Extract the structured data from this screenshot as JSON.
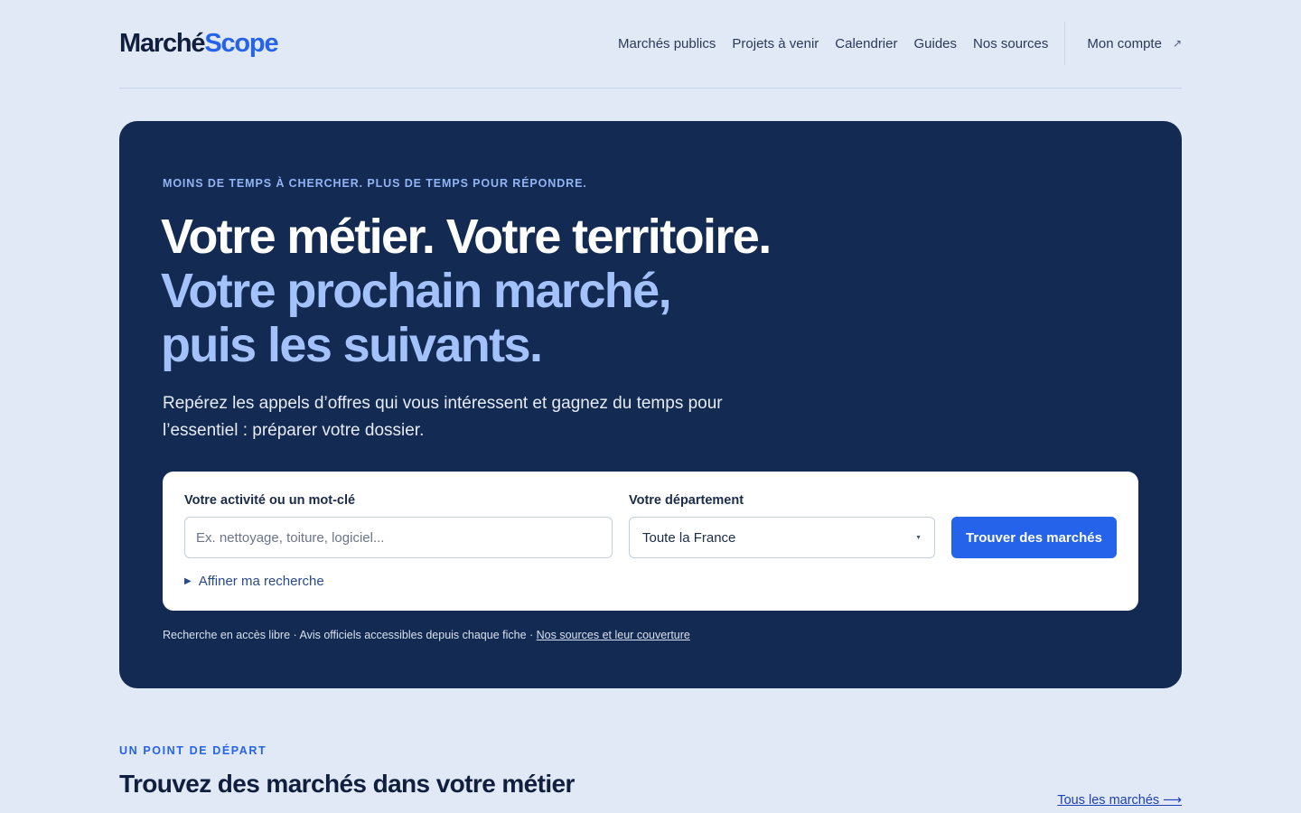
{
  "brand": {
    "part1": "Marché",
    "part2": "Scope"
  },
  "nav": {
    "links": [
      "Marchés publics",
      "Projets à venir",
      "Calendrier",
      "Guides",
      "Nos sources"
    ],
    "account_label": "Mon compte",
    "account_icon": "external-arrow-icon"
  },
  "hero": {
    "eyebrow": "MOINS DE TEMPS À CHERCHER. PLUS DE TEMPS POUR RÉPONDRE.",
    "headline_line1": "Votre métier. Votre territoire.",
    "headline_line2": "Votre prochain marché,",
    "headline_line3": "puis les suivants.",
    "lead": "Repérez les appels d’offres qui vous intéressent et gagnez du temps pour l’essentiel : préparer votre dossier."
  },
  "search": {
    "keyword_label": "Votre activité ou un mot-clé",
    "keyword_placeholder": "Ex. nettoyage, toiture, logiciel...",
    "keyword_value": "",
    "department_label": "Votre département",
    "department_value": "Toute la France",
    "submit_label": "Trouver des marchés",
    "refine_label": "Affiner ma recherche"
  },
  "note": {
    "text": "Recherche en accès libre · Avis officiels accessibles depuis chaque fiche · ",
    "link": "Nos sources et leur couverture"
  },
  "section": {
    "eyebrow": "UN POINT DE DÉPART",
    "title": "Trouvez des marchés dans votre métier",
    "link": "Tous les marchés ⟶"
  },
  "colors": {
    "page_bg": "#e2e9f6",
    "hero_bg": "#132a52",
    "accent": "#2563eb",
    "headline_accent": "#a3c1fb"
  }
}
